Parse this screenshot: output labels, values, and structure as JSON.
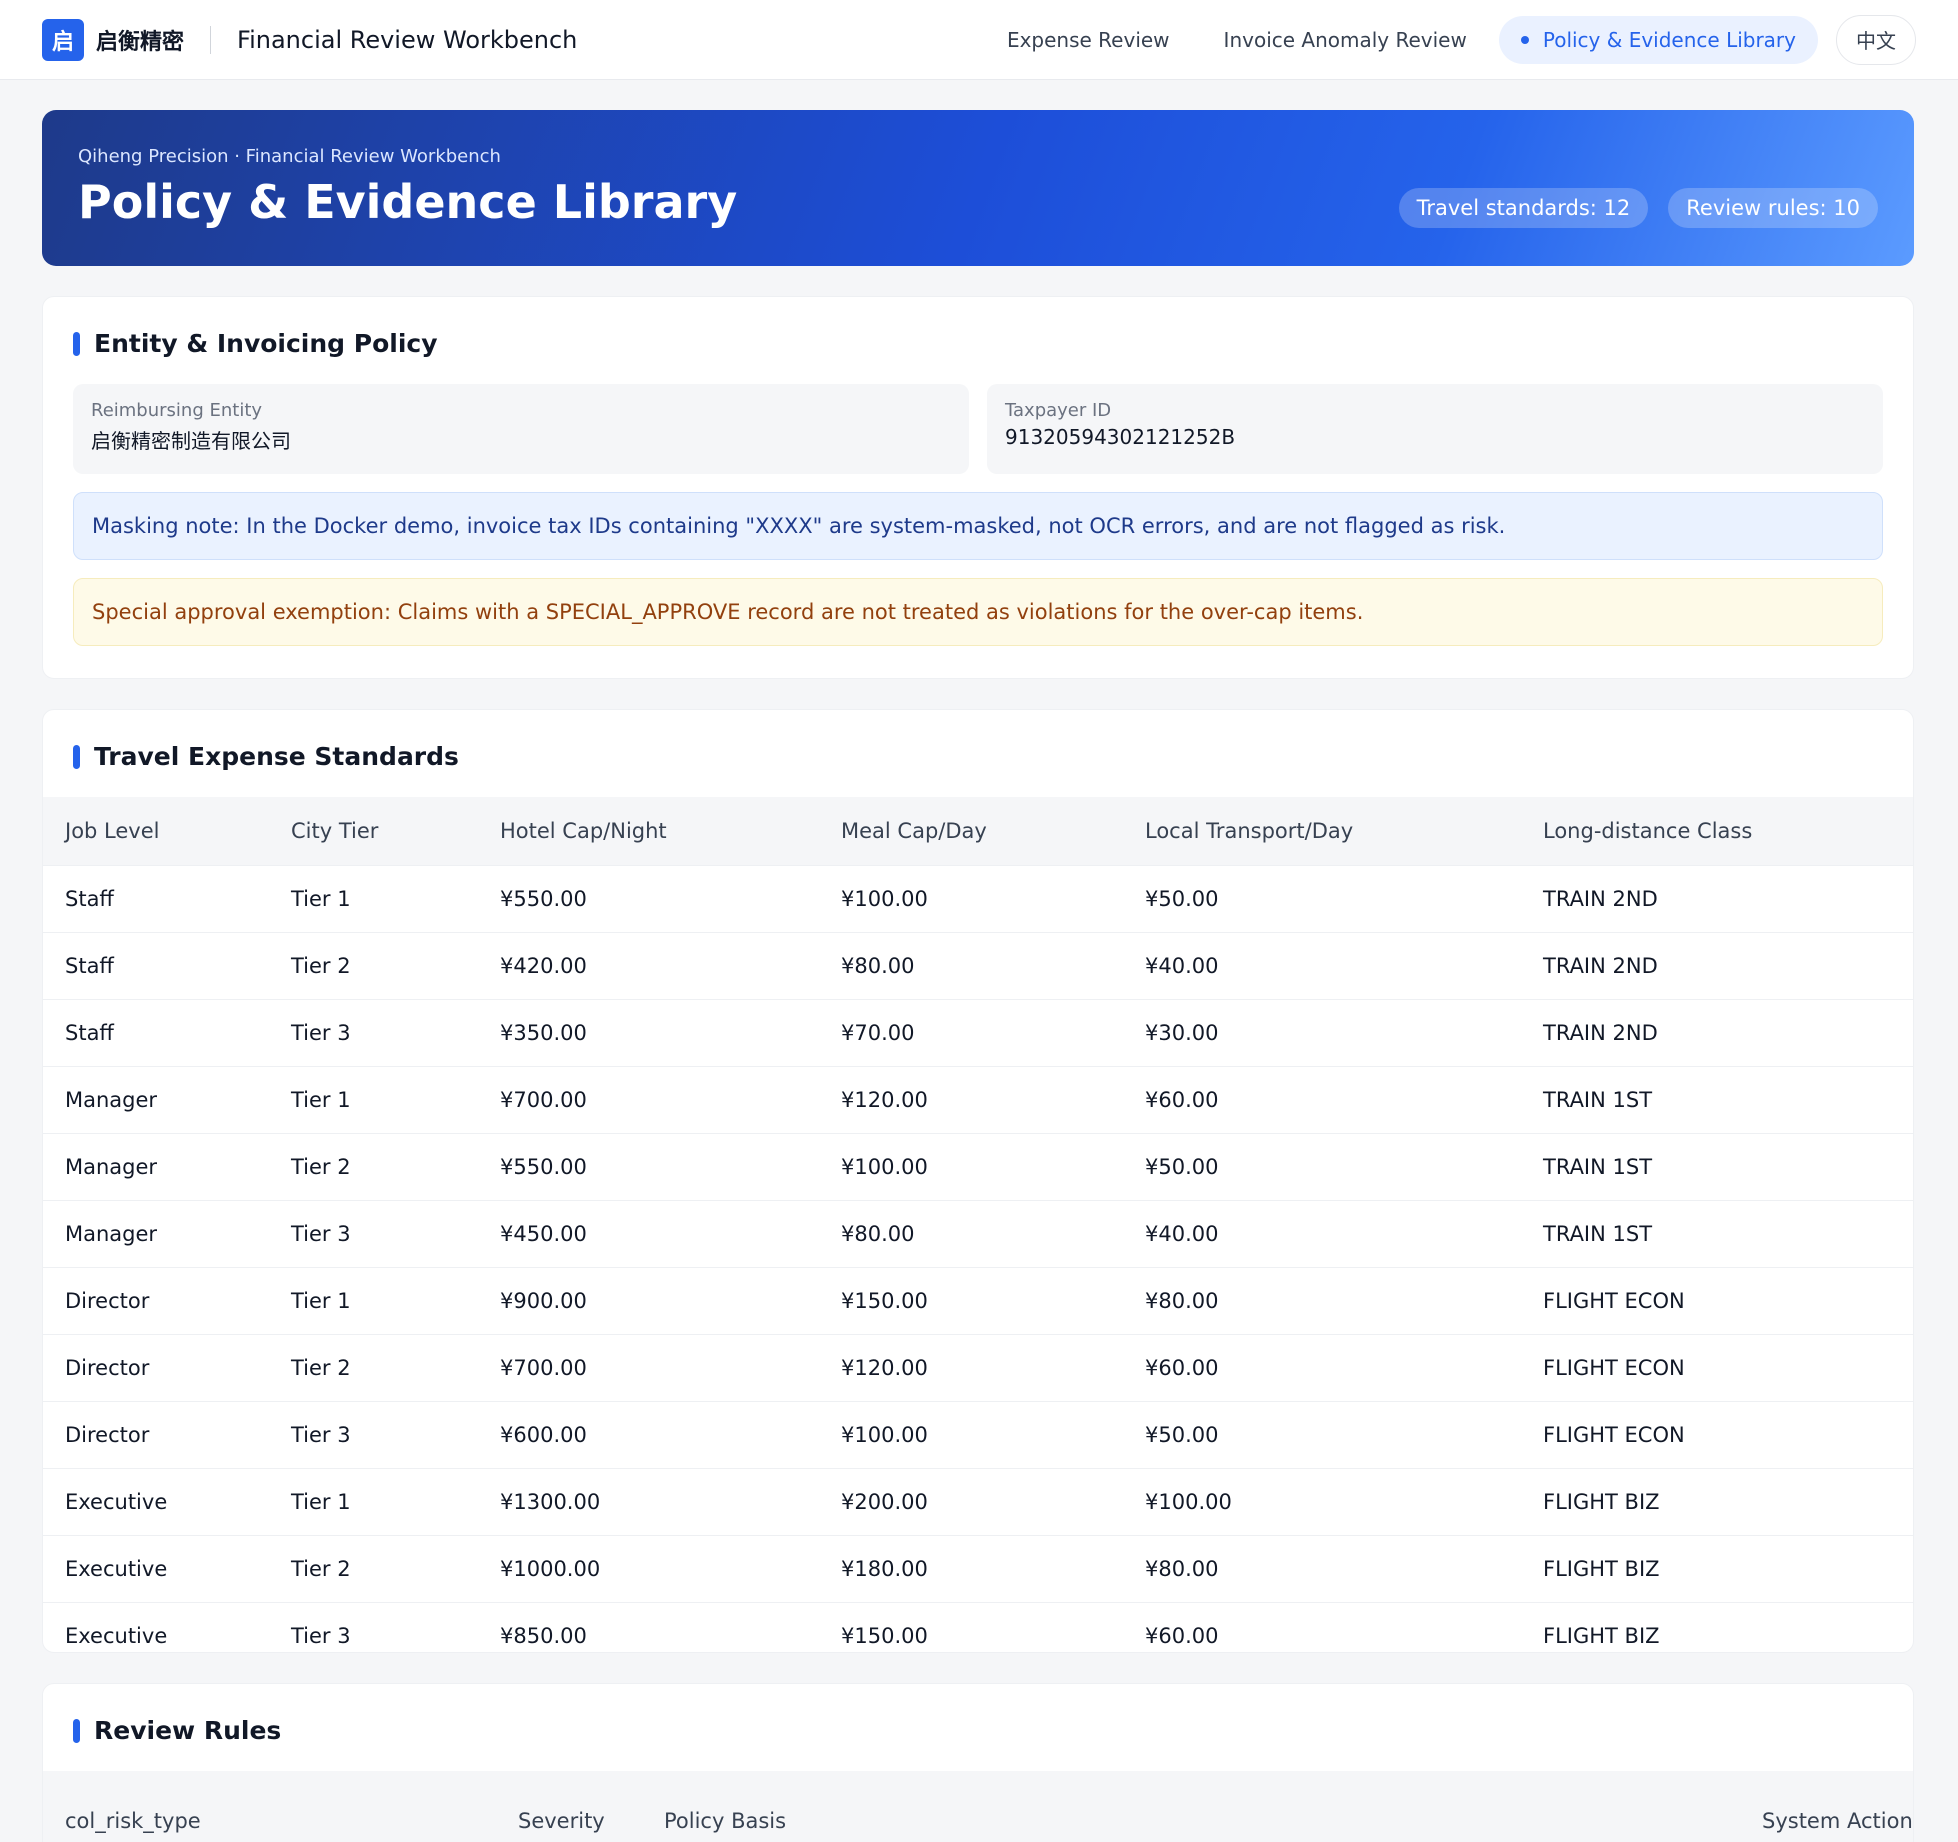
{
  "app": {
    "logo_char": "启",
    "brand_cn": "启衡精密",
    "title": "Financial Review Workbench"
  },
  "nav": {
    "items": [
      {
        "label": "Expense Review"
      },
      {
        "label": "Invoice Anomaly Review"
      },
      {
        "label": "Policy & Evidence Library",
        "active": true
      }
    ],
    "lang_button": "中文"
  },
  "hero": {
    "subtitle": "Qiheng Precision · Financial Review Workbench",
    "title": "Policy & Evidence Library",
    "travel_standards": "Travel standards: 12",
    "review_rules": "Review rules: 10"
  },
  "entity": {
    "title": "Entity & Invoicing Policy",
    "reimbursing_entity_label": "Reimbursing Entity",
    "reimbursing_entity_value": "启衡精密制造有限公司",
    "taxpayer_id_label": "Taxpayer ID",
    "taxpayer_id_value": "91320594302121252B",
    "masking_note": "Masking note: In the Docker demo, invoice tax IDs containing \"XXXX\" are system-masked, not OCR errors, and are not flagged as risk.",
    "special_note": "Special approval exemption: Claims with a SPECIAL_APPROVE record are not treated as violations for the over-cap items."
  },
  "travel": {
    "title": "Travel Expense Standards",
    "headers": [
      "Job Level",
      "City Tier",
      "Hotel Cap/Night",
      "Meal Cap/Day",
      "Local Transport/Day",
      "Long-distance Class"
    ],
    "rows": [
      [
        "Staff",
        "Tier 1",
        "¥550.00",
        "¥100.00",
        "¥50.00",
        "TRAIN 2ND"
      ],
      [
        "Staff",
        "Tier 2",
        "¥420.00",
        "¥80.00",
        "¥40.00",
        "TRAIN 2ND"
      ],
      [
        "Staff",
        "Tier 3",
        "¥350.00",
        "¥70.00",
        "¥30.00",
        "TRAIN 2ND"
      ],
      [
        "Manager",
        "Tier 1",
        "¥700.00",
        "¥120.00",
        "¥60.00",
        "TRAIN 1ST"
      ],
      [
        "Manager",
        "Tier 2",
        "¥550.00",
        "¥100.00",
        "¥50.00",
        "TRAIN 1ST"
      ],
      [
        "Manager",
        "Tier 3",
        "¥450.00",
        "¥80.00",
        "¥40.00",
        "TRAIN 1ST"
      ],
      [
        "Director",
        "Tier 1",
        "¥900.00",
        "¥150.00",
        "¥80.00",
        "FLIGHT ECON"
      ],
      [
        "Director",
        "Tier 2",
        "¥700.00",
        "¥120.00",
        "¥60.00",
        "FLIGHT ECON"
      ],
      [
        "Director",
        "Tier 3",
        "¥600.00",
        "¥100.00",
        "¥50.00",
        "FLIGHT ECON"
      ],
      [
        "Executive",
        "Tier 1",
        "¥1300.00",
        "¥200.00",
        "¥100.00",
        "FLIGHT BIZ"
      ],
      [
        "Executive",
        "Tier 2",
        "¥1000.00",
        "¥180.00",
        "¥80.00",
        "FLIGHT BIZ"
      ],
      [
        "Executive",
        "Tier 3",
        "¥850.00",
        "¥150.00",
        "¥60.00",
        "FLIGHT BIZ"
      ]
    ]
  },
  "rules": {
    "title": "Review Rules",
    "headers": [
      "col_risk_type",
      "Severity",
      "Policy Basis",
      "System Action"
    ]
  }
}
